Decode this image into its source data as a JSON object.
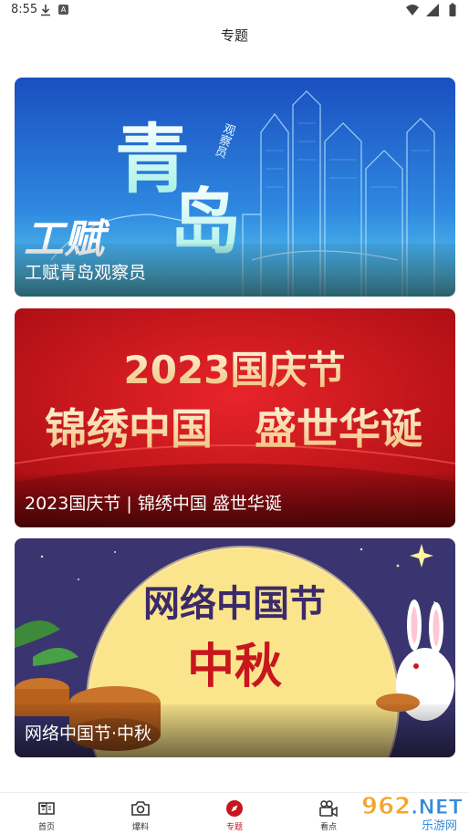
{
  "status_bar": {
    "time": "8:55",
    "icons": [
      "download-icon",
      "a-icon",
      "wifi-icon",
      "signal-icon",
      "battery-icon"
    ]
  },
  "header": {
    "title": "专题"
  },
  "cards": [
    {
      "caption": "工赋青岛观察员",
      "art_text": {
        "main_a": "青",
        "main_b": "岛",
        "sub": "工赋",
        "vertical": "观察员"
      },
      "colors": {
        "bg_top": "#1a4fc0",
        "bg_bottom": "#5fd3f0"
      }
    },
    {
      "caption": "2023国庆节 | 锦绣中国 盛世华诞",
      "art_text": {
        "line1": "2023国庆节",
        "line2a": "锦绣中国",
        "line2b": "盛世华诞"
      },
      "colors": {
        "bg": "#c8161d",
        "accent": "#f7d9a0"
      }
    },
    {
      "caption": "网络中国节·中秋",
      "art_text": {
        "line1": "网络中国节",
        "line2": "中秋"
      },
      "colors": {
        "bg": "#3a3570",
        "moon": "#fbe58c",
        "text": "#3a2a6a",
        "accent": "#c8161d"
      }
    }
  ],
  "bottom_nav": {
    "items": [
      {
        "label": "首页",
        "icon": "home-icon",
        "active": false
      },
      {
        "label": "爆料",
        "icon": "camera-icon",
        "active": false
      },
      {
        "label": "专题",
        "icon": "compass-icon",
        "active": true
      },
      {
        "label": "看点",
        "icon": "video-icon",
        "active": false
      }
    ],
    "active_color": "#c8161d"
  },
  "watermark": {
    "text": "962.NET",
    "sub": "乐游网"
  }
}
